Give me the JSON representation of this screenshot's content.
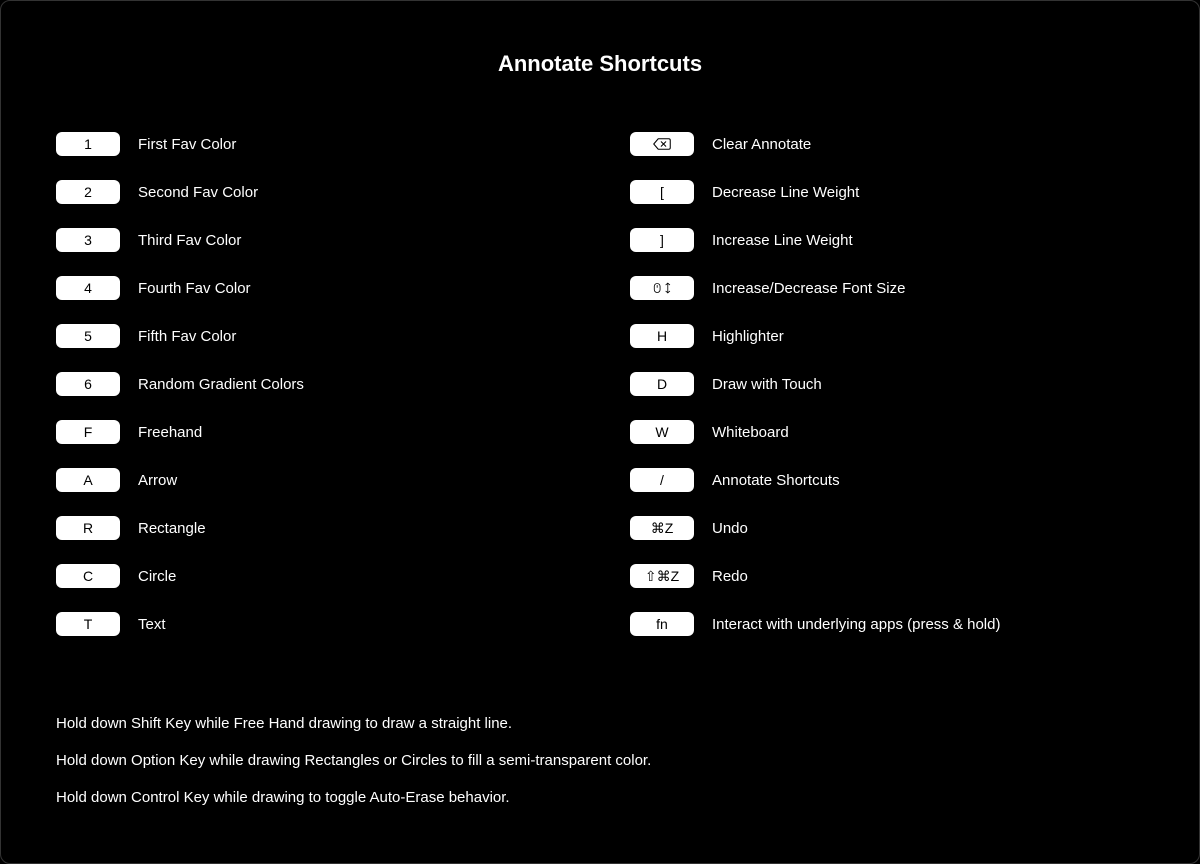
{
  "title": "Annotate Shortcuts",
  "left": [
    {
      "key": "1",
      "label": "First Fav Color"
    },
    {
      "key": "2",
      "label": "Second Fav Color"
    },
    {
      "key": "3",
      "label": "Third Fav Color"
    },
    {
      "key": "4",
      "label": "Fourth Fav Color"
    },
    {
      "key": "5",
      "label": "Fifth Fav Color"
    },
    {
      "key": "6",
      "label": "Random Gradient Colors"
    },
    {
      "key": "F",
      "label": "Freehand"
    },
    {
      "key": "A",
      "label": "Arrow"
    },
    {
      "key": "R",
      "label": "Rectangle"
    },
    {
      "key": "C",
      "label": "Circle"
    },
    {
      "key": "T",
      "label": "Text"
    }
  ],
  "right": [
    {
      "key": "backspace-icon",
      "label": "Clear Annotate",
      "icon": true
    },
    {
      "key": "[",
      "label": "Decrease Line Weight"
    },
    {
      "key": "]",
      "label": "Increase Line Weight"
    },
    {
      "key": "scroll-icon",
      "label": "Increase/Decrease Font Size",
      "icon": true
    },
    {
      "key": "H",
      "label": "Highlighter"
    },
    {
      "key": "D",
      "label": "Draw with Touch"
    },
    {
      "key": "W",
      "label": "Whiteboard"
    },
    {
      "key": "/",
      "label": "Annotate Shortcuts"
    },
    {
      "key": "⌘Z",
      "label": "Undo"
    },
    {
      "key": "⇧⌘Z",
      "label": "Redo"
    },
    {
      "key": "fn",
      "label": "Interact with underlying apps (press & hold)"
    }
  ],
  "hints": [
    "Hold down Shift Key while Free Hand drawing to draw a straight line.",
    "Hold down Option Key while drawing Rectangles or Circles to fill a semi-transparent color.",
    "Hold down Control Key while drawing to toggle Auto-Erase behavior."
  ]
}
